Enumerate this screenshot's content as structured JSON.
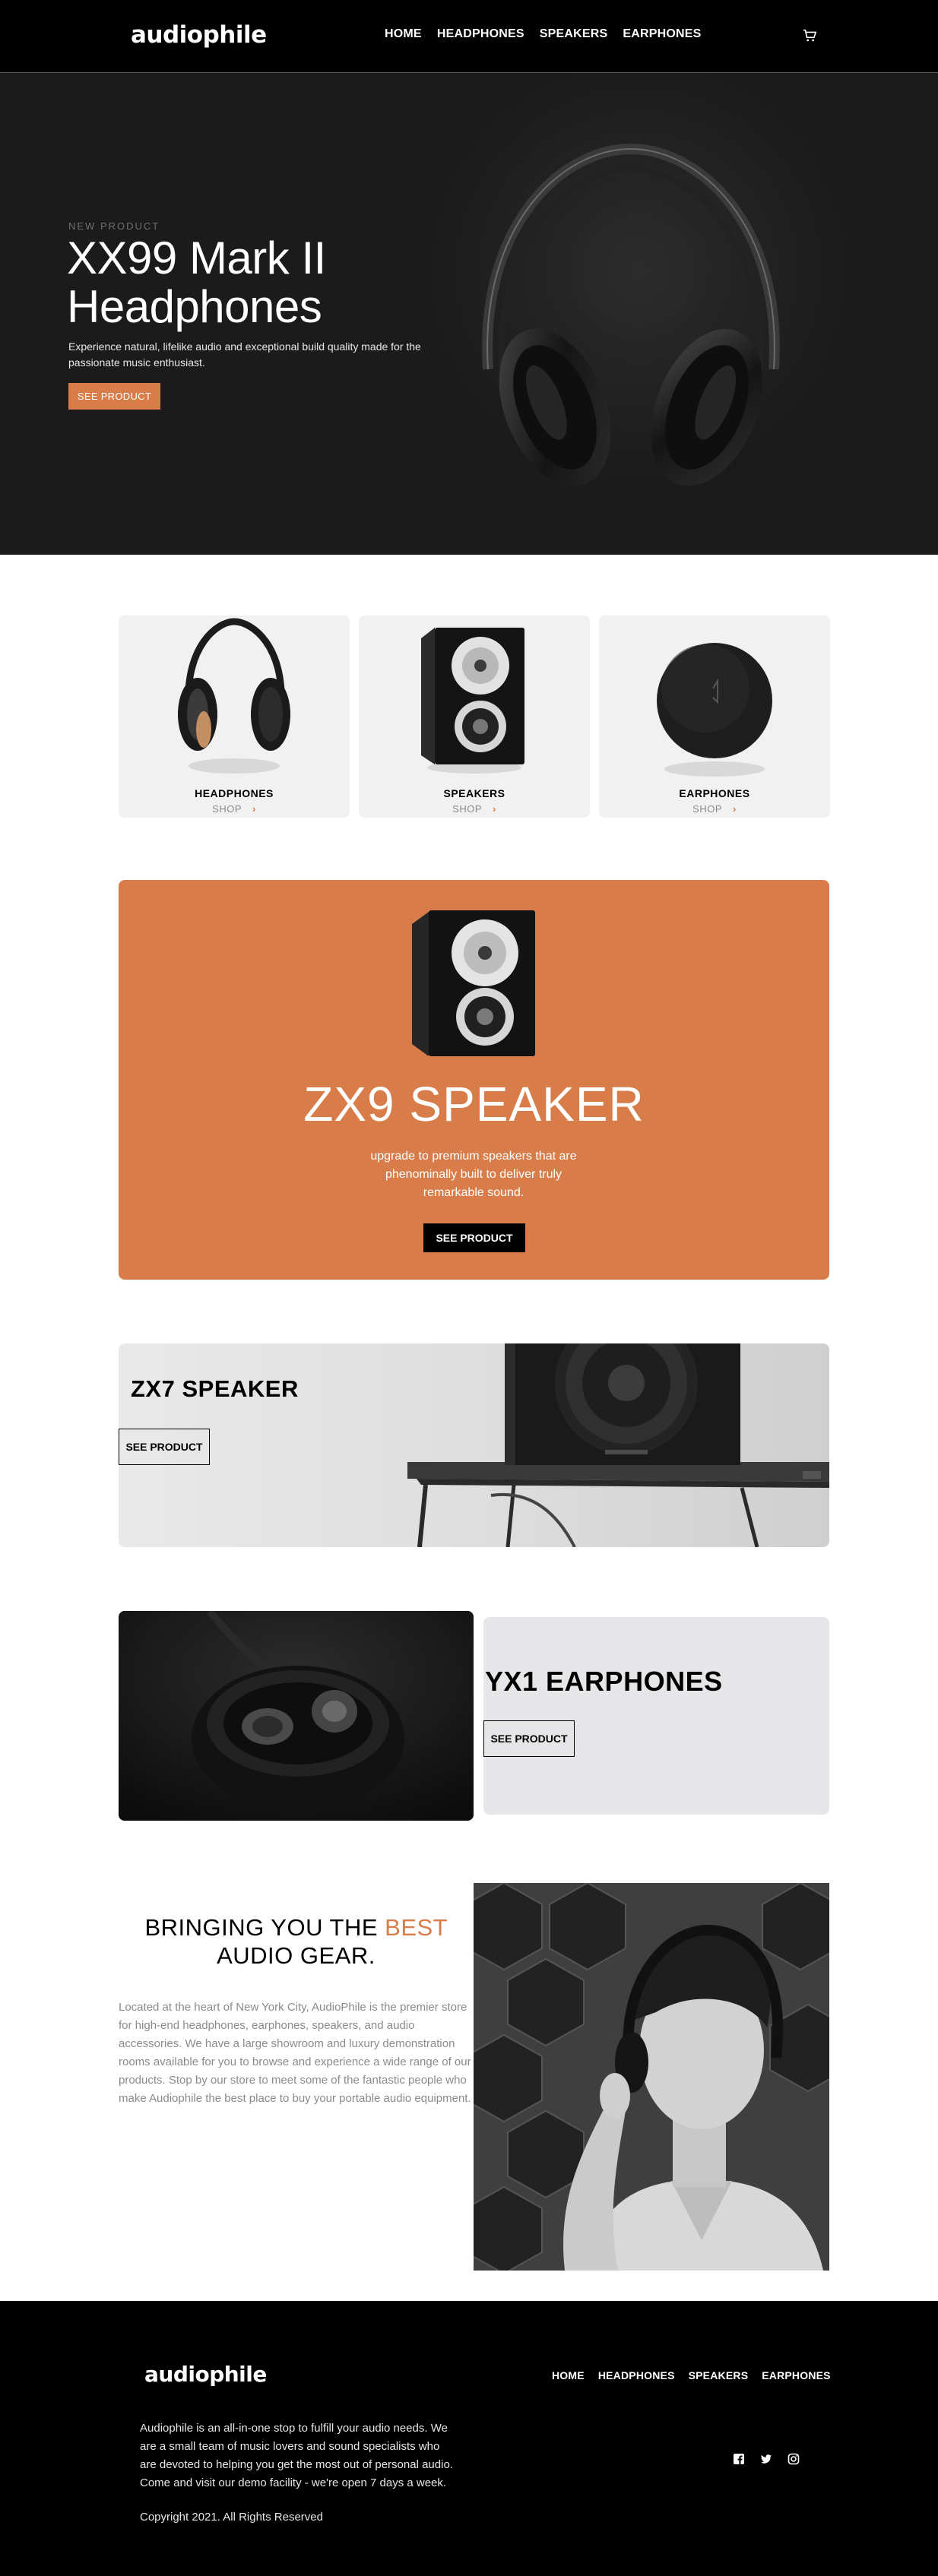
{
  "header": {
    "logo": "audiophile",
    "nav": [
      "HOME",
      "HEADPHONES",
      "SPEAKERS",
      "EARPHONES"
    ],
    "cart_icon": "cart-icon"
  },
  "hero": {
    "overline": "NEW PRODUCT",
    "title_line1": "XX99 Mark II",
    "title_line2": "Headphones",
    "description": "Experience natural, lifelike audio and exceptional build quality made for the passionate music enthusiast.",
    "button": "SEE PRODUCT"
  },
  "categories": [
    {
      "title": "HEADPHONES",
      "shop": "SHOP",
      "icon": "chevron-right-icon"
    },
    {
      "title": "SPEAKERS",
      "shop": "SHOP",
      "icon": "chevron-right-icon"
    },
    {
      "title": "EARPHONES",
      "shop": "SHOP",
      "icon": "chevron-right-icon"
    }
  ],
  "zx9": {
    "title": "ZX9 SPEAKER",
    "description": "upgrade to premium speakers that are phenominally built to deliver truly remarkable sound.",
    "button": "SEE PRODUCT"
  },
  "zx7": {
    "title": "ZX7 SPEAKER",
    "button": "SEE PRODUCT"
  },
  "yx1": {
    "title": "YX1 EARPHONES",
    "button": "SEE PRODUCT"
  },
  "about": {
    "title_before": "BRINGING YOU THE ",
    "title_accent": "BEST",
    "title_after": " AUDIO GEAR.",
    "text": "Located at the heart of New York City, AudioPhile is the premier store for high-end headphones, earphones, speakers, and audio accessories. We have a large showroom and luxury demonstration rooms available for you to browse and experience a wide range of our products. Stop by our store to meet some of the fantastic people who make Audiophile the best place to buy your portable audio equipment."
  },
  "footer": {
    "logo": "audiophile",
    "nav": [
      "HOME",
      "HEADPHONES",
      "SPEAKERS",
      "EARPHONES"
    ],
    "description": "Audiophile is an all-in-one stop to fulfill your audio needs. We are a small team of music lovers and sound specialists who are devoted to helping you get the most out of personal audio. Come and visit our demo facility - we're open 7 days a week.",
    "copyright": "Copyright 2021. All Rights Reserved",
    "socials": [
      "facebook-icon",
      "twitter-icon",
      "instagram-icon"
    ]
  },
  "colors": {
    "accent": "#d87d4a",
    "dark": "#000000",
    "hero_bg": "#1b1b1b",
    "card_bg": "#f1f1f1"
  }
}
